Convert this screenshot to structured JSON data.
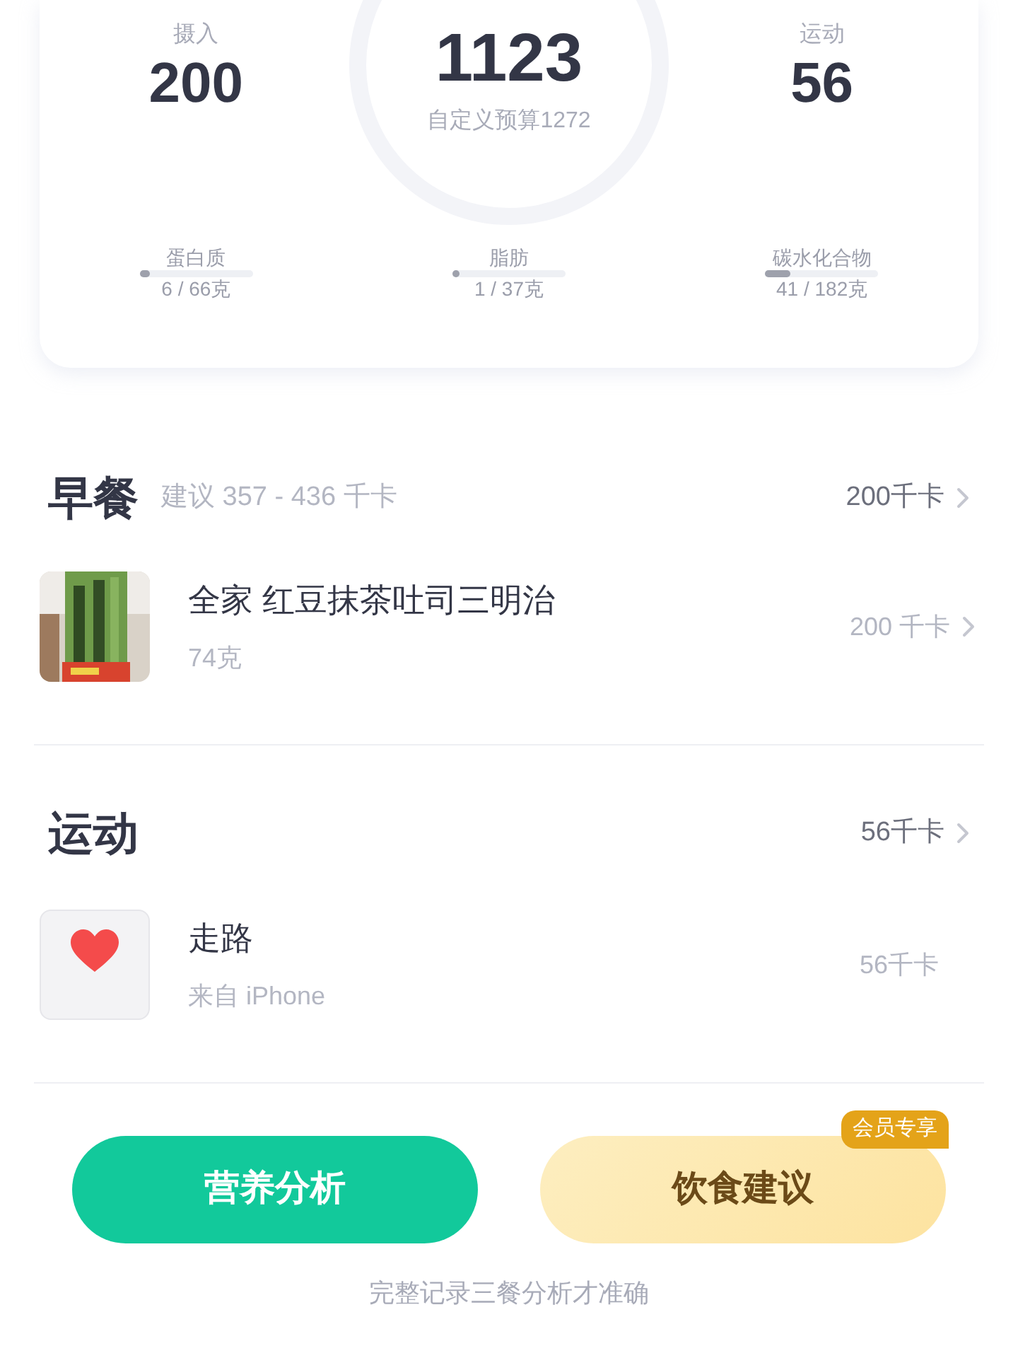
{
  "summary": {
    "intake": {
      "label": "摄入",
      "value": "200"
    },
    "center": {
      "value": "1123",
      "caption": "自定义预算1272"
    },
    "exercise": {
      "label": "运动",
      "value": "56"
    },
    "macros": [
      {
        "label": "蛋白质",
        "level": 0.09,
        "reading": "6 / 66克"
      },
      {
        "label": "脂肪",
        "level": 0.03,
        "reading": "1 / 37克"
      },
      {
        "label": "碳水化合物",
        "level": 0.22,
        "reading": "41 / 182克"
      }
    ]
  },
  "sections": [
    {
      "title": "早餐",
      "hint": "建议 357 - 436 千卡",
      "total": "200千卡",
      "items": [
        {
          "kind": "food",
          "name": "全家 红豆抹茶吐司三明治",
          "detail": "74克",
          "calories": "200 千卡",
          "arrow": true
        }
      ]
    },
    {
      "title": "运动",
      "total": "56千卡",
      "items": [
        {
          "kind": "exercise",
          "name": "走路",
          "detail": "来自 iPhone",
          "calories": "56千卡",
          "arrow": false
        }
      ]
    }
  ],
  "buttons": [
    {
      "kind": "primary",
      "label": "营养分析"
    },
    {
      "kind": "premium",
      "label": "饮食建议",
      "badge": "会员专享"
    }
  ],
  "footer": "完整记录三餐分析才准确"
}
